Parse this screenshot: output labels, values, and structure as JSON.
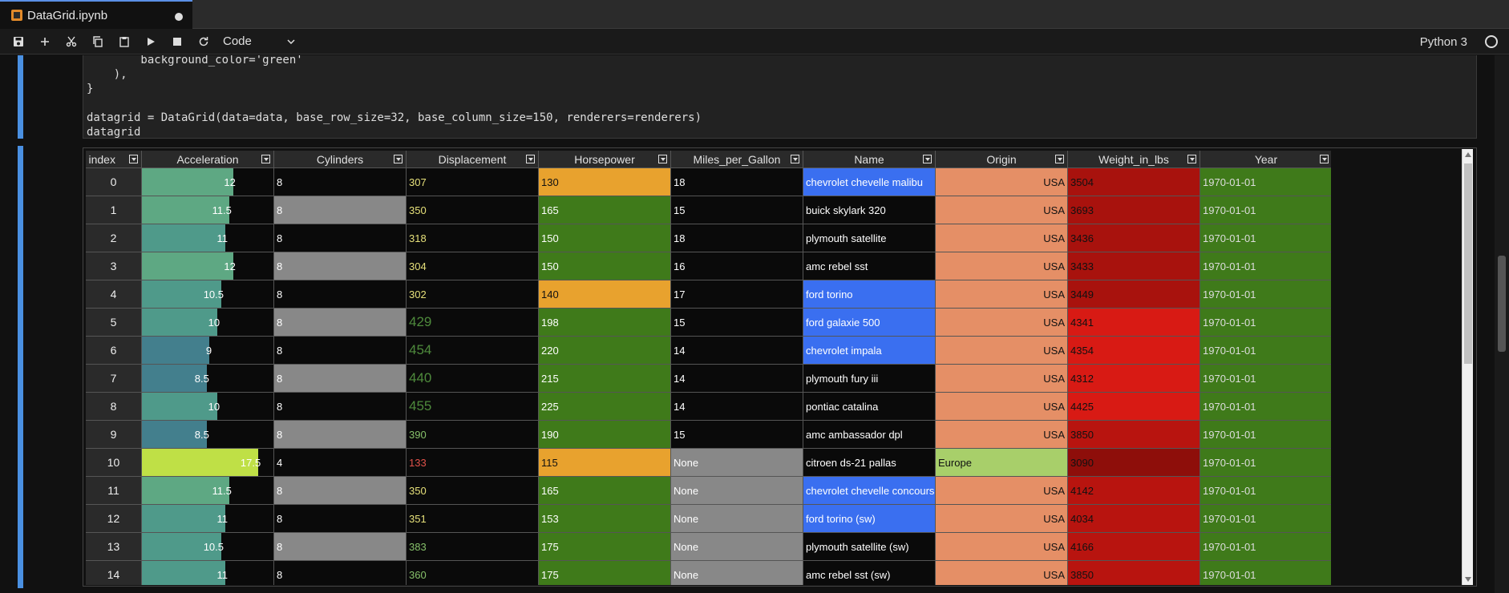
{
  "tab": {
    "title": "DataGrid.ipynb"
  },
  "toolbar": {
    "cell_type": "Code",
    "kernel": "Python 3"
  },
  "code": {
    "line1": "        background_color='green'",
    "line2": "    ),",
    "line3": "}",
    "line5": "datagrid = DataGrid(data=data, base_row_size=32, base_column_size=150, renderers=renderers)",
    "line6": "datagrid"
  },
  "grid": {
    "columns": [
      "index",
      "Acceleration",
      "Cylinders",
      "Displacement",
      "Horsepower",
      "Miles_per_Gallon",
      "Name",
      "Origin",
      "Weight_in_lbs",
      "Year"
    ],
    "rows": [
      {
        "index": "0",
        "acc": "12",
        "acc_frac": 0.69,
        "cyl": "8",
        "disp": "307",
        "hp": "130",
        "mpg": "18",
        "name": "chevrolet chevelle malibu",
        "origin": "USA",
        "weight": "3504",
        "year": "1970-01-01"
      },
      {
        "index": "1",
        "acc": "11.5",
        "acc_frac": 0.66,
        "cyl": "8",
        "disp": "350",
        "hp": "165",
        "mpg": "15",
        "name": "buick skylark 320",
        "origin": "USA",
        "weight": "3693",
        "year": "1970-01-01"
      },
      {
        "index": "2",
        "acc": "11",
        "acc_frac": 0.63,
        "cyl": "8",
        "disp": "318",
        "hp": "150",
        "mpg": "18",
        "name": "plymouth satellite",
        "origin": "USA",
        "weight": "3436",
        "year": "1970-01-01"
      },
      {
        "index": "3",
        "acc": "12",
        "acc_frac": 0.69,
        "cyl": "8",
        "disp": "304",
        "hp": "150",
        "mpg": "16",
        "name": "amc rebel sst",
        "origin": "USA",
        "weight": "3433",
        "year": "1970-01-01"
      },
      {
        "index": "4",
        "acc": "10.5",
        "acc_frac": 0.6,
        "cyl": "8",
        "disp": "302",
        "hp": "140",
        "mpg": "17",
        "name": "ford torino",
        "origin": "USA",
        "weight": "3449",
        "year": "1970-01-01"
      },
      {
        "index": "5",
        "acc": "10",
        "acc_frac": 0.57,
        "cyl": "8",
        "disp": "429",
        "hp": "198",
        "mpg": "15",
        "name": "ford galaxie 500",
        "origin": "USA",
        "weight": "4341",
        "year": "1970-01-01"
      },
      {
        "index": "6",
        "acc": "9",
        "acc_frac": 0.51,
        "cyl": "8",
        "disp": "454",
        "hp": "220",
        "mpg": "14",
        "name": "chevrolet impala",
        "origin": "USA",
        "weight": "4354",
        "year": "1970-01-01"
      },
      {
        "index": "7",
        "acc": "8.5",
        "acc_frac": 0.49,
        "cyl": "8",
        "disp": "440",
        "hp": "215",
        "mpg": "14",
        "name": "plymouth fury iii",
        "origin": "USA",
        "weight": "4312",
        "year": "1970-01-01"
      },
      {
        "index": "8",
        "acc": "10",
        "acc_frac": 0.57,
        "cyl": "8",
        "disp": "455",
        "hp": "225",
        "mpg": "14",
        "name": "pontiac catalina",
        "origin": "USA",
        "weight": "4425",
        "year": "1970-01-01"
      },
      {
        "index": "9",
        "acc": "8.5",
        "acc_frac": 0.49,
        "cyl": "8",
        "disp": "390",
        "hp": "190",
        "mpg": "15",
        "name": "amc ambassador dpl",
        "origin": "USA",
        "weight": "3850",
        "year": "1970-01-01"
      },
      {
        "index": "10",
        "acc": "17.5",
        "acc_frac": 0.88,
        "cyl": "4",
        "disp": "133",
        "hp": "115",
        "mpg": "None",
        "name": "citroen ds-21 pallas",
        "origin": "Europe",
        "weight": "3090",
        "year": "1970-01-01"
      },
      {
        "index": "11",
        "acc": "11.5",
        "acc_frac": 0.66,
        "cyl": "8",
        "disp": "350",
        "hp": "165",
        "mpg": "None",
        "name": "chevrolet chevelle concours (sw)",
        "origin": "USA",
        "weight": "4142",
        "year": "1970-01-01"
      },
      {
        "index": "12",
        "acc": "11",
        "acc_frac": 0.63,
        "cyl": "8",
        "disp": "351",
        "hp": "153",
        "mpg": "None",
        "name": "ford torino (sw)",
        "origin": "USA",
        "weight": "4034",
        "year": "1970-01-01"
      },
      {
        "index": "13",
        "acc": "10.5",
        "acc_frac": 0.6,
        "cyl": "8",
        "disp": "383",
        "hp": "175",
        "mpg": "None",
        "name": "plymouth satellite (sw)",
        "origin": "USA",
        "weight": "4166",
        "year": "1970-01-01"
      },
      {
        "index": "14",
        "acc": "11",
        "acc_frac": 0.63,
        "cyl": "8",
        "disp": "360",
        "hp": "175",
        "mpg": "None",
        "name": "amc rebel sst (sw)",
        "origin": "USA",
        "weight": "3850",
        "year": "1970-01-01"
      }
    ]
  },
  "colors": {
    "accent": "#4a90e2",
    "hp_orange": "#e8a22e",
    "green": "#3f7a1a",
    "name_blue": "#3a6ff0",
    "origin_usa": "#e58f66",
    "origin_europe": "#a8cf6a",
    "cyl_gray": "#888888"
  }
}
